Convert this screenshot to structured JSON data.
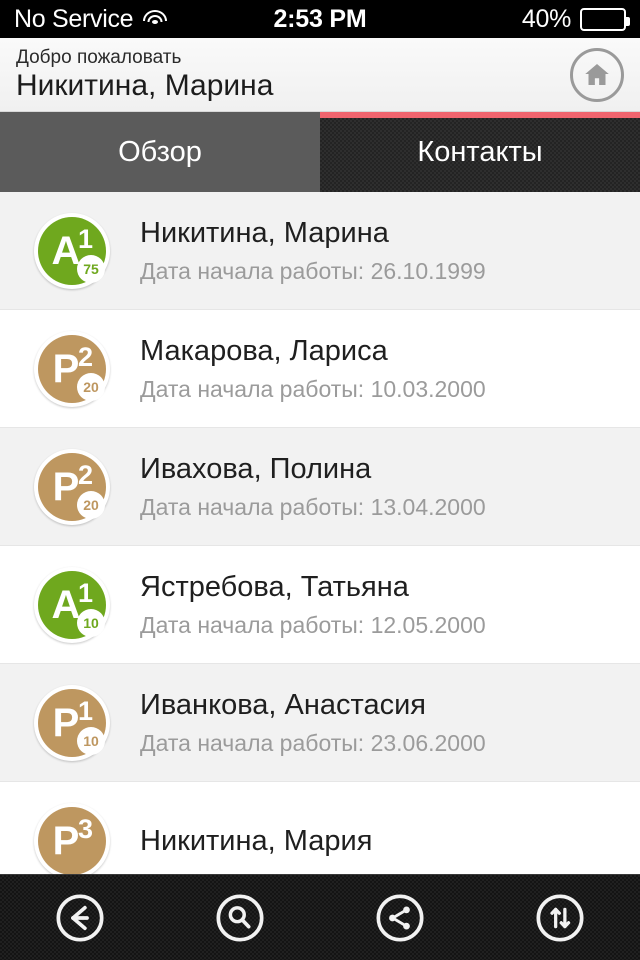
{
  "status_bar": {
    "carrier": "No Service",
    "wifi_icon": "wifi-icon",
    "time": "2:53 PM",
    "battery_percent": "40%",
    "battery_level": 40
  },
  "header": {
    "welcome_label": "Добро пожаловать",
    "user_name": "Никитина, Марина",
    "home_icon": "home-icon"
  },
  "tabs": {
    "active_index": 1,
    "accent_color": "#f0646e",
    "items": [
      {
        "label": "Обзор",
        "active": false
      },
      {
        "label": "Контакты",
        "active": true
      }
    ]
  },
  "colors": {
    "badge_green": "#6FA81E",
    "badge_tan": "#BE9760",
    "tab_accent": "#f0646e",
    "row_alt_bg": "#f2f2f2",
    "subtitle": "#9b9b9b"
  },
  "list": {
    "rows": [
      {
        "name": "Никитина, Марина",
        "subtitle": "Дата начала работы: 26.10.1999",
        "badge": {
          "letter": "A",
          "rank": "1",
          "score": "75",
          "color": "#6FA81E"
        }
      },
      {
        "name": "Макарова, Лариса",
        "subtitle": "Дата начала работы: 10.03.2000",
        "badge": {
          "letter": "P",
          "rank": "2",
          "score": "20",
          "color": "#BE9760"
        }
      },
      {
        "name": "Ивахова, Полина",
        "subtitle": "Дата начала работы: 13.04.2000",
        "badge": {
          "letter": "P",
          "rank": "2",
          "score": "20",
          "color": "#BE9760"
        }
      },
      {
        "name": "Ястребова, Татьяна",
        "subtitle": "Дата начала работы: 12.05.2000",
        "badge": {
          "letter": "A",
          "rank": "1",
          "score": "10",
          "color": "#6FA81E"
        }
      },
      {
        "name": "Иванкова, Анастасия",
        "subtitle": "Дата начала работы: 23.06.2000",
        "badge": {
          "letter": "P",
          "rank": "1",
          "score": "10",
          "color": "#BE9760"
        }
      },
      {
        "name": "Никитина, Мария",
        "subtitle": "",
        "badge": {
          "letter": "P",
          "rank": "3",
          "score": "",
          "color": "#BE9760"
        }
      }
    ]
  },
  "toolbar": {
    "buttons": [
      {
        "icon": "back-arrow-icon",
        "label": "Back"
      },
      {
        "icon": "search-icon",
        "label": "Search"
      },
      {
        "icon": "share-icon",
        "label": "Share"
      },
      {
        "icon": "sort-icon",
        "label": "Sort"
      }
    ]
  }
}
